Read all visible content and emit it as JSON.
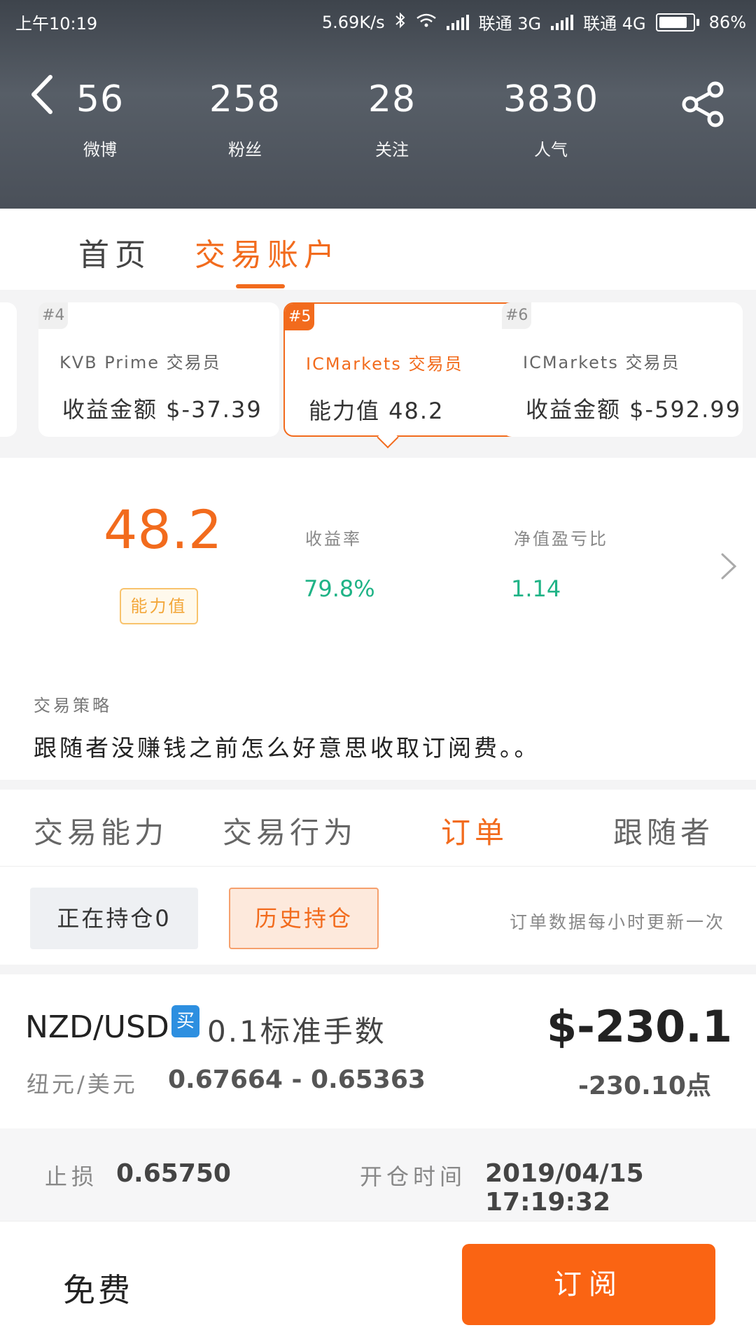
{
  "status_bar": {
    "time": "上午10:19",
    "speed": "5.69K/s",
    "carrier1": "联通 3G",
    "carrier2": "联通 4G",
    "battery": "86%",
    "battery_level": 0.86
  },
  "profile_stats": [
    {
      "value": "56",
      "label": "微博"
    },
    {
      "value": "258",
      "label": "粉丝"
    },
    {
      "value": "28",
      "label": "关注"
    },
    {
      "value": "3830",
      "label": "人气"
    }
  ],
  "main_tabs": [
    "首页",
    "交易账户"
  ],
  "trader_cards": [
    {
      "rank": "#4",
      "name": "KVB Prime 交易员",
      "value": "收益金额 $-37.39"
    },
    {
      "rank": "#5",
      "name": "ICMarkets 交易员",
      "value": "能力值 48.2"
    },
    {
      "rank": "#6",
      "name": "ICMarkets 交易员",
      "value": "收益金额 $-592.99"
    }
  ],
  "summary": {
    "score": "48.2",
    "score_label": "能力值",
    "return_label": "收益率",
    "return_value": "79.8%",
    "ratio_label": "净值盈亏比",
    "ratio_value": "1.14",
    "strategy_label": "交易策略",
    "strategy_text": "跟随者没赚钱之前怎么好意思收取订阅费。。"
  },
  "section_tabs": [
    "交易能力",
    "交易行为",
    "订单",
    "跟随者"
  ],
  "positions": {
    "open_label": "正在持仓0",
    "history_label": "历史持仓",
    "update_note": "订单数据每小时更新一次"
  },
  "order": {
    "pair": "NZD/USD",
    "side": "买",
    "lots": "0.1标准手数",
    "pair_cn": "纽元/美元",
    "prices": "0.67664 - 0.65363",
    "pnl": "$-230.1",
    "pips": "-230.10点",
    "stop_loss_label": "止损",
    "stop_loss": "0.65750",
    "open_time_label": "开仓时间",
    "open_time": "2019/04/15 17:19:32"
  },
  "bottom": {
    "price_label": "免费",
    "subscribe_label": "订阅"
  },
  "colors": {
    "accent": "#f26b1d",
    "positive": "#1fb386",
    "buy_tag": "#2d8fe0",
    "header_bg": "#4a5059"
  }
}
